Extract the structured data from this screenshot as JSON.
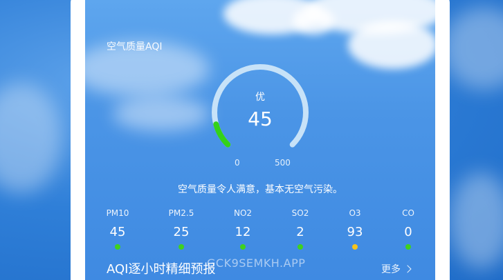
{
  "air_quality": {
    "section_title": "空气质量AQI",
    "level": "优",
    "aqi_value": "45",
    "aqi_number": 45,
    "scale_min": "0",
    "scale_max": "500",
    "scale_max_number": 500,
    "description": "空气质量令人满意，基本无空气污染。",
    "gauge_colors": {
      "track": "#c7e2f8",
      "fill": "#34d219"
    }
  },
  "pollutants": [
    {
      "name": "PM10",
      "value": "45",
      "dot_color": "#3fd11e"
    },
    {
      "name": "PM2.5",
      "value": "25",
      "dot_color": "#3fd11e"
    },
    {
      "name": "NO2",
      "value": "12",
      "dot_color": "#3fd11e"
    },
    {
      "name": "SO2",
      "value": "2",
      "dot_color": "#3fd11e"
    },
    {
      "name": "O3",
      "value": "93",
      "dot_color": "#f5c41d"
    },
    {
      "name": "CO",
      "value": "0",
      "dot_color": "#3fd11e"
    }
  ],
  "hourly": {
    "title": "AQI逐小时精细预报",
    "more_label": "更多",
    "more_icon": "chevron-right-icon"
  },
  "watermark": "GCK9SEMKH.APP"
}
